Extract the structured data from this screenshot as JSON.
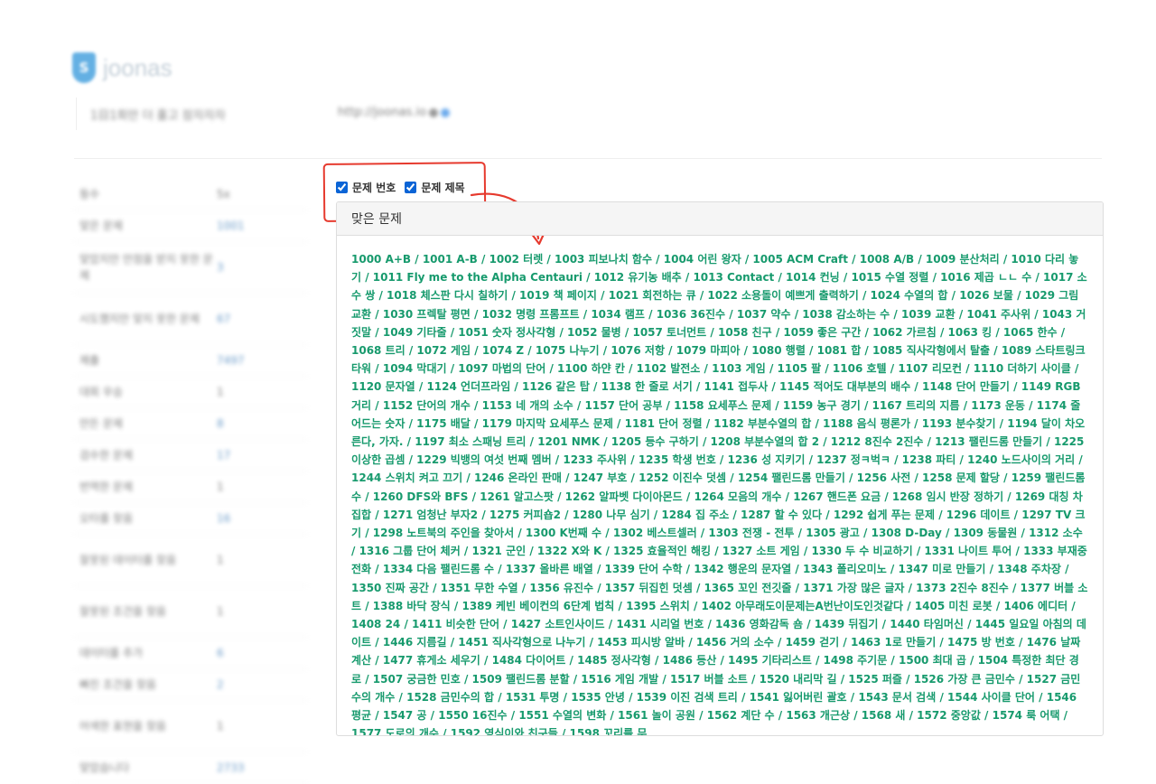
{
  "logo": {
    "glyph": "S",
    "text": "joonas"
  },
  "profile": {
    "status_message": "1日1회만 더 풀고 잠자자자",
    "homepage": "http://joonas.io"
  },
  "stats": [
    {
      "label": "등수",
      "value": "5x"
    },
    {
      "label": "맞은 문제",
      "value": "1001"
    },
    {
      "label": "맞았지만 만점을 받지 못한 문제",
      "value": "3"
    },
    {
      "label": "시도했지만 맞지 못한 문제",
      "value": "67"
    },
    {
      "label": "제출",
      "value": "7497"
    },
    {
      "label": "대회 우승",
      "value": "1"
    },
    {
      "label": "만든 문제",
      "value": "8"
    },
    {
      "label": "검수한 문제",
      "value": "17"
    },
    {
      "label": "번역한 문제",
      "value": "1"
    },
    {
      "label": "오타를 찾음",
      "value": "16"
    },
    {
      "label": "잘못된 데이터를 찾음",
      "value": "1"
    },
    {
      "label": "잘못된 조건을 찾음",
      "value": "1"
    },
    {
      "label": "데이터를 추가",
      "value": "6"
    },
    {
      "label": "빠진 조건을 찾음",
      "value": "2"
    },
    {
      "label": "어색한 표현을 찾음",
      "value": "1"
    },
    {
      "label": "맞았습니다",
      "value": "2733"
    }
  ],
  "filters": {
    "number_label": "문제 번호",
    "number_checked": true,
    "title_label": "문제 제목",
    "title_checked": true
  },
  "panel": {
    "title": "맞은 문제",
    "problems": [
      "1000 A+B",
      "1001 A-B",
      "1002 터렛",
      "1003 피보나치 함수",
      "1004 어린 왕자",
      "1005 ACM Craft",
      "1008 A/B",
      "1009 분산처리",
      "1010 다리 놓기",
      "1011 Fly me to the Alpha Centauri",
      "1012 유기농 배추",
      "1013 Contact",
      "1014 컨닝",
      "1015 수열 정렬",
      "1016 제곱 ㄴㄴ 수",
      "1017 소수 쌍",
      "1018 체스판 다시 칠하기",
      "1019 책 페이지",
      "1021 회전하는 큐",
      "1022 소용돌이 예쁘게 출력하기",
      "1024 수열의 합",
      "1026 보물",
      "1029 그림 교환",
      "1030 프렉탈 평면",
      "1032 명령 프롬프트",
      "1034 램프",
      "1036 36진수",
      "1037 약수",
      "1038 감소하는 수",
      "1039 교환",
      "1041 주사위",
      "1043 거짓말",
      "1049 기타줄",
      "1051 숫자 정사각형",
      "1052 물병",
      "1057 토너먼트",
      "1058 친구",
      "1059 좋은 구간",
      "1062 가르침",
      "1063 킹",
      "1065 한수",
      "1068 트리",
      "1072 게임",
      "1074 Z",
      "1075 나누기",
      "1076 저항",
      "1079 마피아",
      "1080 행렬",
      "1081 합",
      "1085 직사각형에서 탈출",
      "1089 스타트링크 타워",
      "1094 막대기",
      "1097 마법의 단어",
      "1100 하얀 칸",
      "1102 발전소",
      "1103 게임",
      "1105 팔",
      "1106 호텔",
      "1107 리모컨",
      "1110 더하기 사이클",
      "1120 문자열",
      "1124 언더프라임",
      "1126 같은 탑",
      "1138 한 줄로 서기",
      "1141 접두사",
      "1145 적어도 대부분의 배수",
      "1148 단어 만들기",
      "1149 RGB거리",
      "1152 단어의 개수",
      "1153 네 개의 소수",
      "1157 단어 공부",
      "1158 요세푸스 문제",
      "1159 농구 경기",
      "1167 트리의 지름",
      "1173 운동",
      "1174 줄어드는 숫자",
      "1175 배달",
      "1179 마지막 요세푸스 문제",
      "1181 단어 정렬",
      "1182 부분수열의 합",
      "1188 음식 평론가",
      "1193 분수찾기",
      "1194 달이 차오른다, 가자.",
      "1197 최소 스패닝 트리",
      "1201 NMK",
      "1205 등수 구하기",
      "1208 부분수열의 합 2",
      "1212 8진수 2진수",
      "1213 팰린드롬 만들기",
      "1225 이상한 곱셈",
      "1229 빅뱅의 여섯 번째 멤버",
      "1233 주사위",
      "1235 학생 번호",
      "1236 성 지키기",
      "1237 정ㅋ벅ㅋ",
      "1238 파티",
      "1240 노드사이의 거리",
      "1244 스위치 켜고 끄기",
      "1246 온라인 판매",
      "1247 부호",
      "1252 이진수 덧셈",
      "1254 팰린드롬 만들기",
      "1256 사전",
      "1258 문제 할당",
      "1259 팰린드롬수",
      "1260 DFS와 BFS",
      "1261 알고스팟",
      "1262 알파벳 다이아몬드",
      "1264 모음의 개수",
      "1267 핸드폰 요금",
      "1268 임시 반장 정하기",
      "1269 대칭 차집합",
      "1271 엄청난 부자2",
      "1275 커피숍2",
      "1280 나무 심기",
      "1284 집 주소",
      "1287 할 수 있다",
      "1292 쉽게 푸는 문제",
      "1296 데이트",
      "1297 TV 크기",
      "1298 노트북의 주인을 찾아서",
      "1300 K번째 수",
      "1302 베스트셀러",
      "1303 전쟁 - 전투",
      "1305 광고",
      "1308 D-Day",
      "1309 동물원",
      "1312 소수",
      "1316 그룹 단어 체커",
      "1321 군인",
      "1322 X와 K",
      "1325 효율적인 해킹",
      "1327 소트 게임",
      "1330 두 수 비교하기",
      "1331 나이트 투어",
      "1333 부재중 전화",
      "1334 다음 팰린드롬 수",
      "1337 올바른 배열",
      "1339 단어 수학",
      "1342 행운의 문자열",
      "1343 폴리오미노",
      "1347 미로 만들기",
      "1348 주차장",
      "1350 진짜 공간",
      "1351 무한 수열",
      "1356 유진수",
      "1357 뒤집힌 덧셈",
      "1365 꼬인 전깃줄",
      "1371 가장 많은 글자",
      "1373 2진수 8진수",
      "1377 버블 소트",
      "1388 바닥 장식",
      "1389 케빈 베이컨의 6단계 법칙",
      "1395 스위치",
      "1402 아무래도이문제는A번난이도인것같다",
      "1405 미친 로봇",
      "1406 에디터",
      "1408 24",
      "1411 비슷한 단어",
      "1427 소트인사이드",
      "1431 시리얼 번호",
      "1436 영화감독 숌",
      "1439 뒤집기",
      "1440 타임머신",
      "1445 일요일 아침의 데이트",
      "1446 지름길",
      "1451 직사각형으로 나누기",
      "1453 피시방 알바",
      "1456 거의 소수",
      "1459 걷기",
      "1463 1로 만들기",
      "1475 방 번호",
      "1476 날짜 계산",
      "1477 휴게소 세우기",
      "1484 다이어트",
      "1485 정사각형",
      "1486 등산",
      "1495 기타리스트",
      "1498 주기문",
      "1500 최대 곱",
      "1504 특정한 최단 경로",
      "1507 궁금한 민호",
      "1509 팰린드롬 분할",
      "1516 게임 개발",
      "1517 버블 소트",
      "1520 내리막 길",
      "1525 퍼즐",
      "1526 가장 큰 금민수",
      "1527 금민수의 개수",
      "1528 금민수의 합",
      "1531 투명",
      "1535 안녕",
      "1539 이진 검색 트리",
      "1541 잃어버린 괄호",
      "1543 문서 검색",
      "1544 사이클 단어",
      "1546 평균",
      "1547 공",
      "1550 16진수",
      "1551 수열의 변화",
      "1561 놀이 공원",
      "1562 계단 수",
      "1563 개근상",
      "1568 새",
      "1572 중앙값",
      "1574 룩 어택",
      "1577 도로의 개수",
      "1592 영식이와 친구들",
      "1598 꼬리를 무"
    ]
  }
}
